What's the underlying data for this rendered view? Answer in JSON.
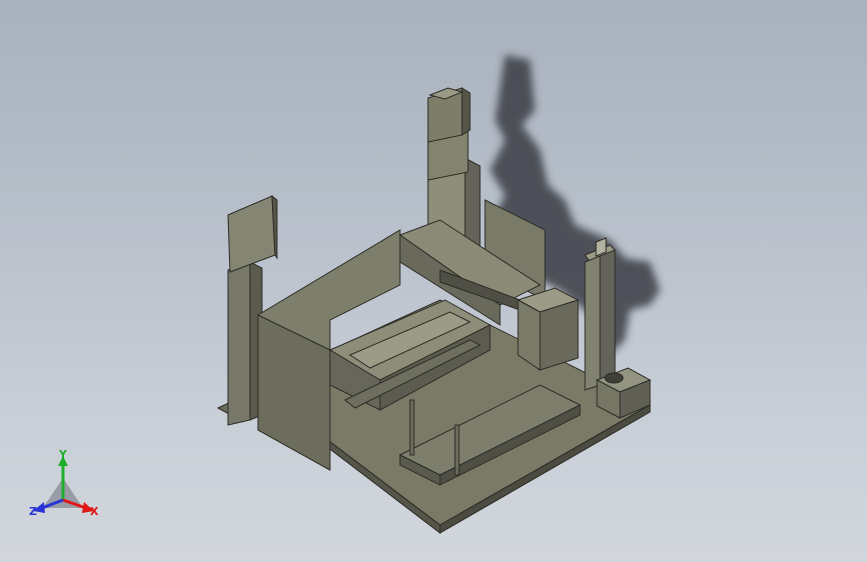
{
  "triad": {
    "y_label": "Y",
    "x_label": "X",
    "z_label": "Z",
    "x_color": "#e01818",
    "y_color": "#1fae2c",
    "z_color": "#2a35d6"
  },
  "colors": {
    "background_top": "#a9b1bd",
    "background_bottom": "#d2d7dd",
    "part_face_light": "#8b8b78",
    "part_face_mid": "#72725f",
    "part_face_dark": "#55554a",
    "shadow": "#3a3e44"
  }
}
